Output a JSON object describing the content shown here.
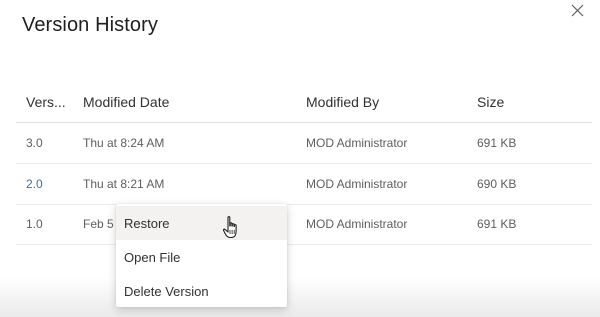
{
  "dialog": {
    "title": "Version History"
  },
  "table": {
    "columns": [
      "Vers...",
      "Modified Date",
      "Modified By",
      "Size"
    ],
    "rows": [
      {
        "version": "3.0",
        "date": "Thu at 8:24 AM",
        "by": "MOD Administrator",
        "size": "691 KB"
      },
      {
        "version": "2.0",
        "date": "Thu at 8:21 AM",
        "by": "MOD Administrator",
        "size": "690 KB"
      },
      {
        "version": "1.0",
        "date": "Feb 5",
        "by": "MOD Administrator",
        "size": "691 KB"
      }
    ]
  },
  "context_menu": {
    "items": [
      "Restore",
      "Open File",
      "Delete Version"
    ],
    "hovered": "Restore"
  },
  "icons": {
    "close": "close-icon",
    "cursor": "hand-pointer-icon"
  },
  "colors": {
    "link": "#3b6fa6",
    "text": "#323130",
    "muted": "#605e5c",
    "hover": "#f3f2f1"
  }
}
